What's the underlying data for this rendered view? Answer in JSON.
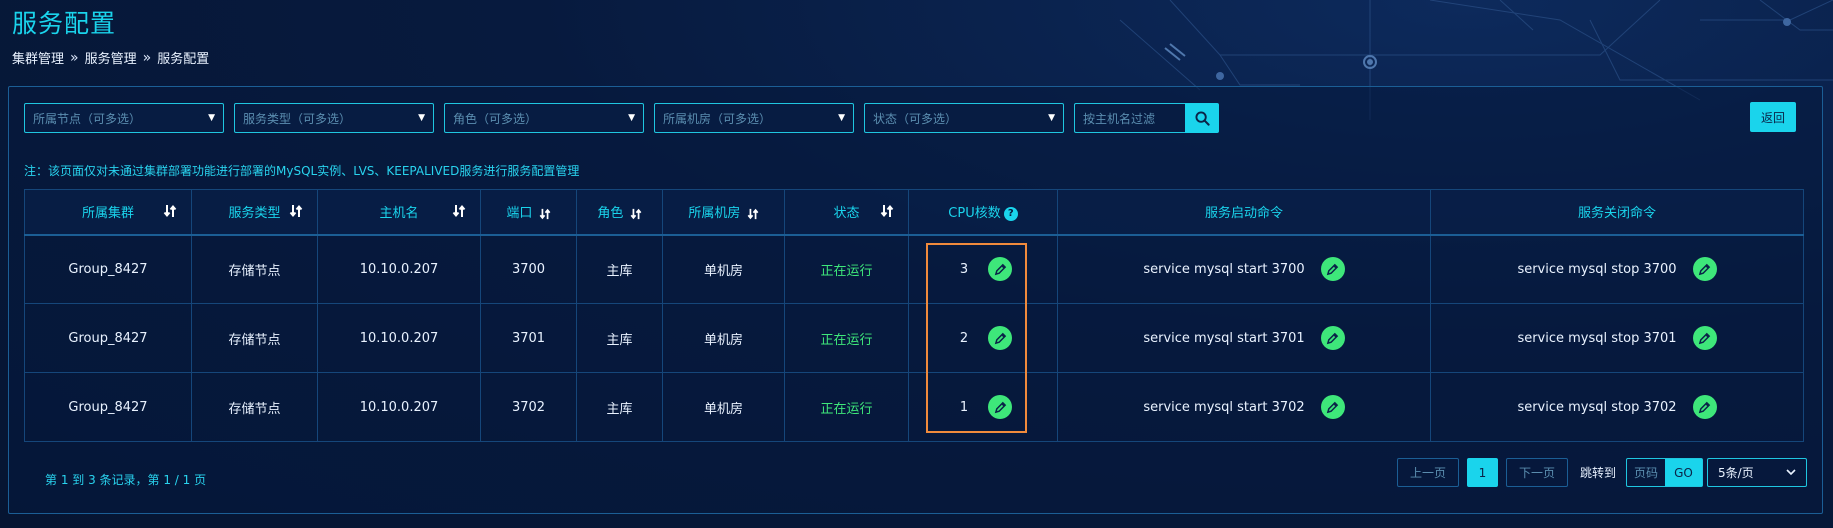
{
  "page": {
    "title": "服务配置",
    "breadcrumb": [
      "集群管理",
      "服务管理",
      "服务配置"
    ]
  },
  "filters": {
    "cluster_node": "所属节点（可多选）",
    "service_type": "服务类型（可多选）",
    "role": "角色（可多选）",
    "room": "所属机房（可多选）",
    "status": "状态（可多选）",
    "search_placeholder": "按主机名过滤"
  },
  "back_label": "返回",
  "note": "注：该页面仅对未通过集群部署功能进行部署的MySQL实例、LVS、KEEPALIVED服务进行服务配置管理",
  "table": {
    "headers": {
      "cluster": "所属集群",
      "service_type": "服务类型",
      "hostname": "主机名",
      "port": "端口",
      "role": "角色",
      "room": "所属机房",
      "status": "状态",
      "cpu": "CPU核数",
      "start_cmd": "服务启动命令",
      "stop_cmd": "服务关闭命令"
    },
    "rows": [
      {
        "cluster": "Group_8427",
        "service_type": "存储节点",
        "hostname": "10.10.0.207",
        "port": "3700",
        "role": "主库",
        "room": "单机房",
        "status": "正在运行",
        "cpu": "3",
        "start_cmd": "service mysql start 3700",
        "stop_cmd": "service mysql stop 3700"
      },
      {
        "cluster": "Group_8427",
        "service_type": "存储节点",
        "hostname": "10.10.0.207",
        "port": "3701",
        "role": "主库",
        "room": "单机房",
        "status": "正在运行",
        "cpu": "2",
        "start_cmd": "service mysql start 3701",
        "stop_cmd": "service mysql stop 3701"
      },
      {
        "cluster": "Group_8427",
        "service_type": "存储节点",
        "hostname": "10.10.0.207",
        "port": "3702",
        "role": "主库",
        "room": "单机房",
        "status": "正在运行",
        "cpu": "1",
        "start_cmd": "service mysql start 3702",
        "stop_cmd": "service mysql stop 3702"
      }
    ]
  },
  "pagination": {
    "summary": "第 1 到 3 条记录，第 1 / 1 页",
    "prev": "上一页",
    "current": "1",
    "next": "下一页",
    "jump_label": "跳转到",
    "page_input_placeholder": "页码",
    "go": "GO",
    "page_size": "5条/页"
  },
  "colors": {
    "accent": "#1ad4ec",
    "running": "#3ee77a",
    "highlight": "#f08a3c"
  }
}
